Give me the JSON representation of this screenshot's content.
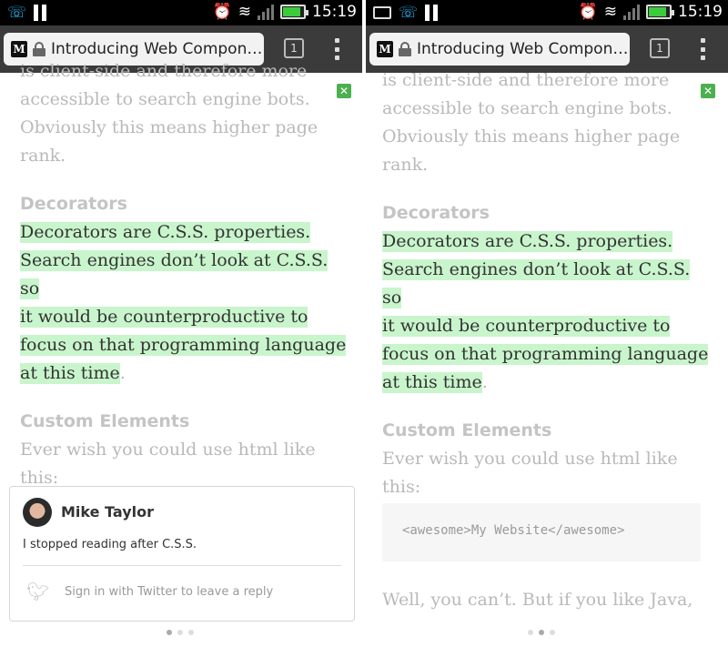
{
  "status_bar": {
    "time": "15:19",
    "icons": [
      "wifi-call-icon",
      "pause-icon",
      "keyboard-icon",
      "alarm-icon",
      "wifi-icon",
      "no-signal-icon",
      "battery-icon"
    ]
  },
  "browser": {
    "tab_title": "Introducing Web Compon…",
    "favicon_letter": "M",
    "tab_count": "1"
  },
  "article": {
    "intro_top": "is client-side and therefore more",
    "intro_lines": [
      "accessible to search engine bots.",
      "Obviously this means higher page",
      "rank."
    ],
    "decorators_heading": "Decorators",
    "decorators_lines": [
      "Decorators are C.S.S. properties.",
      "Search engines don’t look at C.S.S. so",
      "it would be counterproductive to",
      "focus on that programming language",
      "at this time"
    ],
    "decorators_period": ".",
    "custom_heading": "Custom Elements",
    "custom_lines": [
      "Ever wish you could use html like",
      "this:"
    ],
    "code": "<awesome>My Website</awesome>",
    "after_code_lines": [
      "Well, you can’t. But if you like Java,"
    ]
  },
  "comment_card": {
    "author": "Mike Taylor",
    "text": "I stopped reading after C.S.S.",
    "signin": "Sign in with Twitter to leave a reply"
  },
  "colors": {
    "highlight": "#c9f5cc",
    "note_icon": "#4caf50",
    "toolbar": "#3b3b3b"
  }
}
